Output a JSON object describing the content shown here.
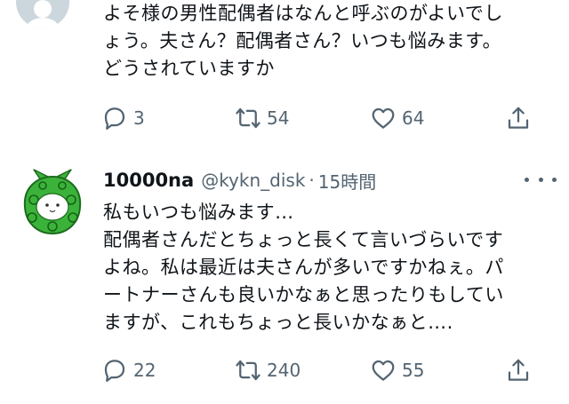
{
  "tweet1": {
    "text": "よそ様の男性配偶者はなんと呼ぶのがよいでし\nょう。夫さん？配偶者さん？いつも悩みます。\nどうされていますか",
    "reply_count": "3",
    "retweet_count": "54",
    "like_count": "64"
  },
  "tweet2": {
    "name": "10000na",
    "handle": "@kykn_disk",
    "separator": "·",
    "time": "15時間",
    "text": "私もいつも悩みます…\n配偶者さんだとちょっと長くて言いづらいです\nよね。私は最近は夫さんが多いですかねぇ。パ\nートナーさんも良いかなぁと思ったりもしてい\nますが、これもちょっと長いかなぁと….",
    "reply_count": "22",
    "retweet_count": "240",
    "like_count": "55"
  },
  "icons": {
    "reply": "reply-icon",
    "retweet": "retweet-icon",
    "like": "heart-icon",
    "share": "share-icon",
    "more": "more-icon"
  },
  "colors": {
    "text_primary": "#0f1419",
    "text_secondary": "#536471",
    "avatar_green": "#3bb33b"
  }
}
